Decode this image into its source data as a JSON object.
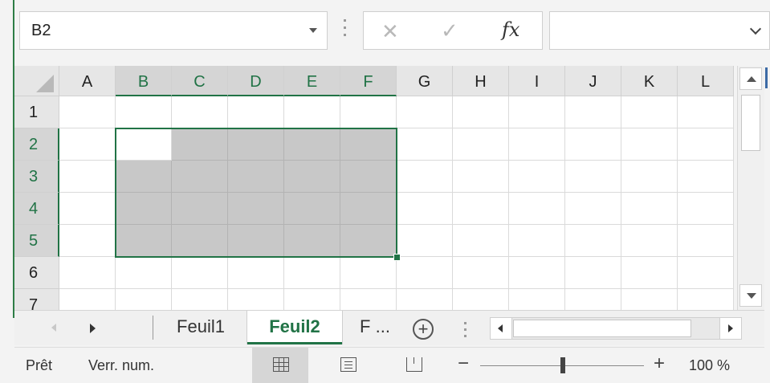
{
  "formula_bar": {
    "name_box_value": "B2",
    "cancel_icon": "close-icon",
    "enter_icon": "checkmark-icon",
    "function_label": "fx",
    "formula_value": ""
  },
  "grid": {
    "columns": [
      "A",
      "B",
      "C",
      "D",
      "E",
      "F",
      "G",
      "H",
      "I",
      "J",
      "K",
      "L"
    ],
    "rows": [
      "1",
      "2",
      "3",
      "4",
      "5",
      "6",
      "7"
    ],
    "active_cell": "B2",
    "selection_range": "B2:F5",
    "accent_color": "#217346"
  },
  "sheet_tabs": {
    "tabs": [
      "Feuil1",
      "Feuil2",
      "F ..."
    ],
    "active_tab": "Feuil2",
    "add_sheet_icon": "plus-circle-icon"
  },
  "status_bar": {
    "mode": "Prêt",
    "num_lock": "Verr. num.",
    "active_view": "normal",
    "zoom_minus": "−",
    "zoom_plus": "+",
    "zoom_level": "100 %"
  }
}
